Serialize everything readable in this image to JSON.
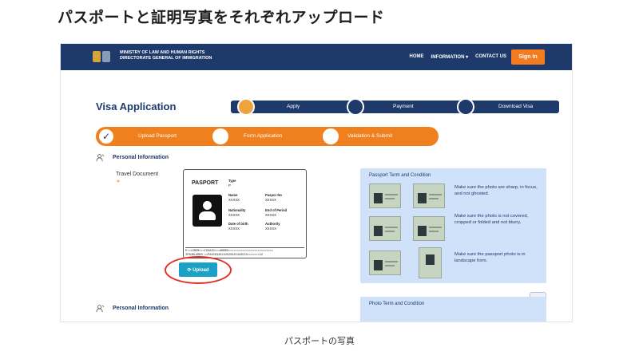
{
  "heading": "パスポートと証明写真をそれぞれアップロード",
  "caption": "パスポートの写真",
  "header": {
    "ministry_line1": "MINISTRY OF LAW AND HUMAN RIGHTS",
    "ministry_line2": "DIRECTORATE GENERAL OF IMMIGRATION",
    "nav": [
      "HOME",
      "INFORMATION ▾",
      "CONTACT US"
    ],
    "signin": "Sign In"
  },
  "visa_title": "Visa Application",
  "main_steps": [
    "Apply",
    "Payment",
    "Download Visa"
  ],
  "sub_steps": [
    "Upload Passport",
    "Form Application",
    "Validation & Submit"
  ],
  "section1": "Personal Information",
  "travel_document_label": "Travel Document",
  "required_mark": "*",
  "passport": {
    "title": "PASPORT",
    "type_label": "Type",
    "type_value": "P",
    "name_label": "Name",
    "name_value": "XXXXX",
    "passport_no_label": "Paspor No",
    "passport_no_value": "XXXXX",
    "nationality_label": "Nationality",
    "nationality_value": "XXXXX",
    "end_of_period_label": "End of Period",
    "end_of_period_value": "XXXXX",
    "dob_label": "Date of birth",
    "dob_value": "XXXXX",
    "authority_label": "Authority",
    "authority_value": "XXXXX",
    "mrz_line1": "P<<LOREM<<<IDSAID<<<AMBRO<<<<<<<<<<<<<<<<<<<<<<<<<<",
    "mrz_line2": "IPSUMLOREM <<P0456345134520325434523<<<<<<<12"
  },
  "upload_button": "⟳ Upload",
  "terms": {
    "title": "Passport Term and Condition",
    "items": [
      "Make sure the photo are sharp, in focus, and not ghosted.",
      "Make sure the photo is not covered, cropped or folded and not blurry.",
      "Make sure the passport photo is in landscape form."
    ]
  },
  "section2": "Personal Information",
  "terms2_title": "Photo Term and Condition",
  "colors": {
    "navy": "#1d3a6b",
    "orange": "#f0801e",
    "upload_teal": "#1aa1c5",
    "highlight_red": "#e42f25",
    "terms_bg": "#cfe2fa"
  }
}
